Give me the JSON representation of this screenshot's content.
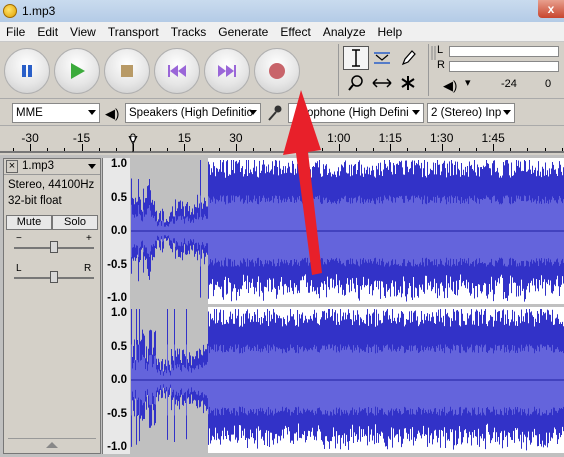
{
  "window": {
    "title": "1.mp3",
    "close_label": "x"
  },
  "menu": [
    "File",
    "Edit",
    "View",
    "Transport",
    "Tracks",
    "Generate",
    "Effect",
    "Analyze",
    "Help"
  ],
  "meters": {
    "left_label": "L",
    "right_label": "R",
    "val_a": "-24",
    "val_b": "0"
  },
  "devices": {
    "host": "MME",
    "output": "Speakers (High Definitio",
    "input": "ophone (High Defini",
    "channels": "2 (Stereo) Inp"
  },
  "ruler": [
    {
      "label": "-30",
      "t": -30
    },
    {
      "label": "-15",
      "t": -15
    },
    {
      "label": "0",
      "t": 0
    },
    {
      "label": "15",
      "t": 15
    },
    {
      "label": "30",
      "t": 30
    },
    {
      "label": "1:00",
      "t": 60
    },
    {
      "label": "1:15",
      "t": 75
    },
    {
      "label": "1:30",
      "t": 90
    },
    {
      "label": "1:45",
      "t": 105
    }
  ],
  "track": {
    "name": "1.mp3",
    "format_line1": "Stereo, 44100Hz",
    "format_line2": "32-bit float",
    "mute_label": "Mute",
    "solo_label": "Solo",
    "gain_minus": "−",
    "gain_plus": "+",
    "pan_left": "L",
    "pan_right": "R",
    "close_label": "×"
  },
  "amp_labels": [
    "1.0",
    "0.5",
    "0.0",
    "-0.5",
    "-1.0"
  ],
  "colors": {
    "waveform": "#3232c8",
    "waveform_rms": "#6464dc",
    "selection": "#c0c0c0",
    "arrow": "#e8202a"
  }
}
